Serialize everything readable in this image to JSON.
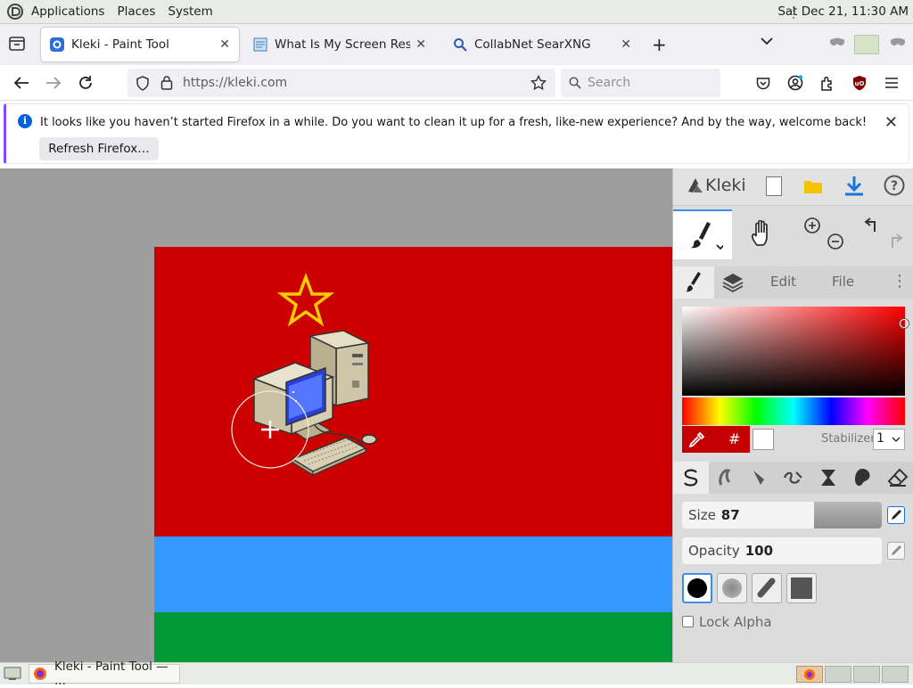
{
  "panel": {
    "menus": [
      "Applications",
      "Places",
      "System"
    ],
    "clock": "Sat Dec 21, 11:30 AM"
  },
  "tabs": [
    {
      "title": "Kleki - Paint Tool",
      "icon": "kleki-icon",
      "active": true
    },
    {
      "title": "What Is My Screen Resolutio",
      "icon": "page-icon",
      "active": false
    },
    {
      "title": "CollabNet SearXNG",
      "icon": "search-icon",
      "active": false
    }
  ],
  "nav": {
    "url": "https://kleki.com",
    "search_placeholder": "Search"
  },
  "notification": {
    "message": "It looks like you haven’t started Firefox in a while. Do you want to clean it up for a fresh, like-new experience? And by the way, welcome back!",
    "button": "Refresh Firefox…"
  },
  "kleki": {
    "logo_text": "Kleki",
    "panel_tabs": [
      "Edit",
      "File"
    ],
    "stabilizer_label": "Stabilizer",
    "stabilizer_value": "1",
    "hash_label": "#",
    "size_label": "Size",
    "size_value": "87",
    "opacity_label": "Opacity",
    "opacity_value": "100",
    "lock_alpha_label": "Lock Alpha",
    "size_fraction": 0.34,
    "current_color": "#c40000"
  },
  "artwork": {
    "colors": {
      "red": "#cc0000",
      "blue": "#3399ff",
      "green": "#009933",
      "star": "#ffcc00"
    }
  },
  "taskbar": {
    "task_label": "Kleki - Paint Tool — ..."
  }
}
